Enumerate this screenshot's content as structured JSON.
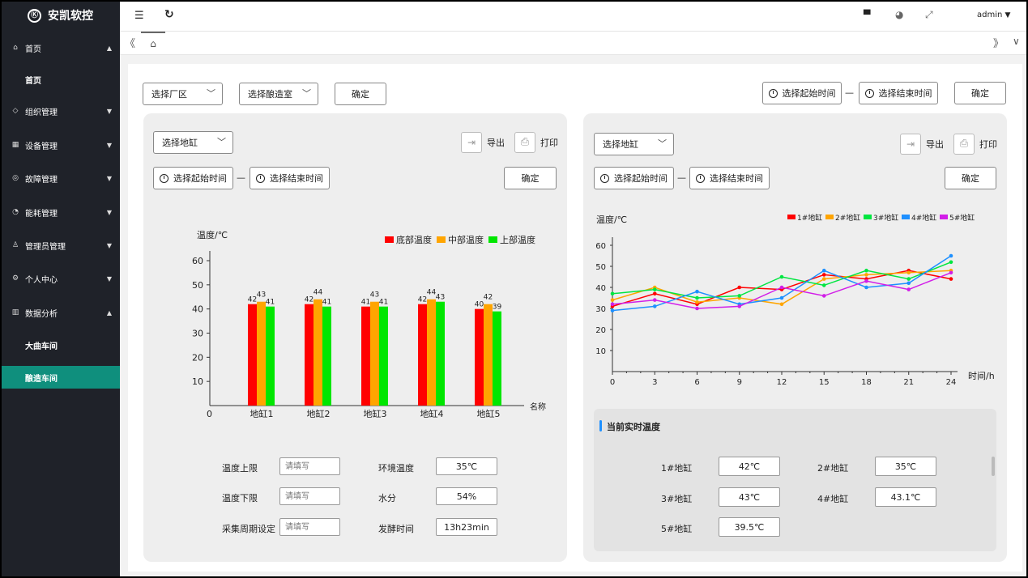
{
  "app": {
    "title": "安凯软控",
    "logo_glyph": "Ⓚ"
  },
  "sidebar": {
    "items": [
      {
        "icon": "⌂",
        "label": "首页",
        "arrow": "▲"
      },
      {
        "label": "首页"
      },
      {
        "icon": "◇",
        "label": "组织管理",
        "arrow": "▼"
      },
      {
        "icon": "▦",
        "label": "设备管理",
        "arrow": "▼"
      },
      {
        "icon": "◎",
        "label": "故障管理",
        "arrow": "▼"
      },
      {
        "icon": "◔",
        "label": "能耗管理",
        "arrow": "▼"
      },
      {
        "icon": "♙",
        "label": "管理员管理",
        "arrow": "▼"
      },
      {
        "icon": "⚙",
        "label": "个人中心",
        "arrow": "▼"
      },
      {
        "icon": "▥",
        "label": "数据分析",
        "arrow": "▲"
      },
      {
        "label": "大曲车间"
      },
      {
        "label": "酿造车间"
      }
    ],
    "colors": {
      "bg": "#1f2229",
      "active": "#0f8f7d"
    }
  },
  "topbar": {
    "menu_icon": "☰",
    "refresh_icon": "↻",
    "monitor_icon": "▀",
    "palette_icon": "◕",
    "fullscreen_icon": "⤢",
    "user": "admin",
    "user_arrow": "▼"
  },
  "tabs": {
    "left": "《",
    "home": "⌂",
    "right": "》",
    "down": "∨"
  },
  "filters": {
    "factory": "选择厂区",
    "room": "选择酿造室",
    "confirm": "确定",
    "start": "选择起始时间",
    "dash": "—",
    "end": "选择结束时间"
  },
  "left_panel": {
    "select": "选择地缸",
    "export": "导出",
    "print": "打印",
    "start": "选择起始时间",
    "dash": "—",
    "end": "选择结束时间",
    "confirm": "确定",
    "form": {
      "upper_label": "温度上限",
      "upper_placeholder": "请填写",
      "lower_label": "温度下限",
      "lower_placeholder": "请填写",
      "period_label": "采集周期设定",
      "period_placeholder": "请填写",
      "env_label": "环境温度",
      "env_value": "35℃",
      "water_label": "水分",
      "water_value": "54%",
      "ferment_label": "发酵时间",
      "ferment_value": "13h23min"
    }
  },
  "right_panel": {
    "select": "选择地缸",
    "export": "导出",
    "print": "打印",
    "start": "选择起始时间",
    "dash": "—",
    "end": "选择结束时间",
    "confirm": "确定",
    "realtime": {
      "title": "当前实时温度",
      "items": [
        {
          "label": "1#地缸",
          "value": "42℃"
        },
        {
          "label": "2#地缸",
          "value": "35℃"
        },
        {
          "label": "3#地缸",
          "value": "43℃"
        },
        {
          "label": "4#地缸",
          "value": "43.1℃"
        },
        {
          "label": "5#地缸",
          "value": "39.5℃"
        }
      ]
    }
  },
  "chart_data": [
    {
      "type": "bar",
      "ylabel": "温度/℃",
      "xlabel": "名称",
      "ylim": [
        0,
        60
      ],
      "yticks": [
        0,
        10,
        20,
        30,
        40,
        50,
        60
      ],
      "legend_position": "top-right",
      "categories": [
        "地缸1",
        "地缸2",
        "地缸3",
        "地缸4",
        "地缸5"
      ],
      "series": [
        {
          "name": "底部温度",
          "color": "#ff0000",
          "values": [
            42,
            42,
            41,
            42,
            40
          ]
        },
        {
          "name": "中部温度",
          "color": "#ffa500",
          "values": [
            43,
            44,
            43,
            44,
            42
          ]
        },
        {
          "name": "上部温度",
          "color": "#00e600",
          "values": [
            41,
            41,
            41,
            43,
            39
          ]
        }
      ]
    },
    {
      "type": "line",
      "ylabel": "温度/℃",
      "xlabel": "时间/h",
      "ylim": [
        0,
        60
      ],
      "yticks": [
        10,
        20,
        30,
        40,
        50,
        60
      ],
      "xticks": [
        0,
        3,
        6,
        9,
        12,
        15,
        18,
        21,
        24
      ],
      "legend_position": "top-right",
      "series": [
        {
          "name": "1#地缸",
          "color": "#ff0000",
          "points": [
            [
              0,
              31
            ],
            [
              3,
              37
            ],
            [
              6,
              32
            ],
            [
              9,
              40
            ],
            [
              12,
              39
            ],
            [
              15,
              46
            ],
            [
              18,
              44
            ],
            [
              21,
              48
            ],
            [
              24,
              44
            ]
          ]
        },
        {
          "name": "2#地缸",
          "color": "#ffa500",
          "points": [
            [
              0,
              34
            ],
            [
              3,
              40
            ],
            [
              6,
              33
            ],
            [
              9,
              35
            ],
            [
              12,
              32
            ],
            [
              15,
              44
            ],
            [
              18,
              46
            ],
            [
              21,
              47
            ],
            [
              24,
              48
            ]
          ]
        },
        {
          "name": "3#地缸",
          "color": "#00e640",
          "points": [
            [
              0,
              37
            ],
            [
              3,
              39
            ],
            [
              6,
              35
            ],
            [
              9,
              36
            ],
            [
              12,
              45
            ],
            [
              15,
              41
            ],
            [
              18,
              48
            ],
            [
              21,
              44
            ],
            [
              24,
              52
            ]
          ]
        },
        {
          "name": "4#地缸",
          "color": "#1e90ff",
          "points": [
            [
              0,
              29
            ],
            [
              3,
              31
            ],
            [
              6,
              38
            ],
            [
              9,
              32
            ],
            [
              12,
              35
            ],
            [
              15,
              48
            ],
            [
              18,
              40
            ],
            [
              21,
              42
            ],
            [
              24,
              55
            ]
          ]
        },
        {
          "name": "5#地缸",
          "color": "#d21ee8",
          "points": [
            [
              0,
              32
            ],
            [
              3,
              34
            ],
            [
              6,
              30
            ],
            [
              9,
              31
            ],
            [
              12,
              40
            ],
            [
              15,
              36
            ],
            [
              18,
              43
            ],
            [
              21,
              39
            ],
            [
              24,
              47
            ]
          ]
        }
      ]
    }
  ]
}
